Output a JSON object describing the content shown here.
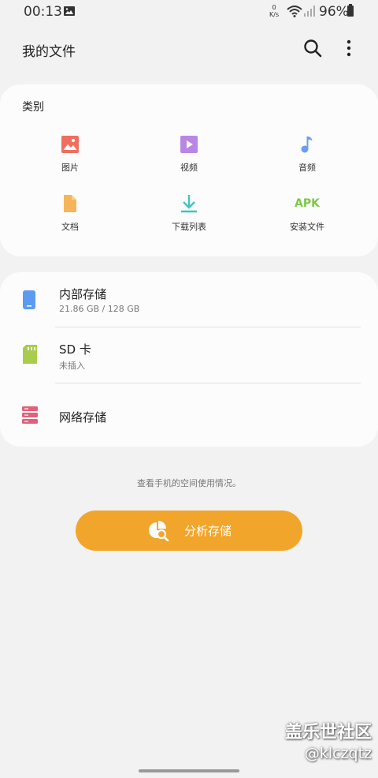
{
  "status_bar": {
    "time": "00:13",
    "speed_top": "0",
    "speed_bottom": "K/s",
    "battery": "96%"
  },
  "app_bar": {
    "title": "我的文件"
  },
  "categories": {
    "title": "类别",
    "items": [
      {
        "label": "图片",
        "icon": "image-icon",
        "color": "#ef6e5f"
      },
      {
        "label": "视频",
        "icon": "video-icon",
        "color": "#b986e6"
      },
      {
        "label": "音频",
        "icon": "music-icon",
        "color": "#6a9ef0"
      },
      {
        "label": "文档",
        "icon": "document-icon",
        "color": "#f5b55a"
      },
      {
        "label": "下载列表",
        "icon": "download-icon",
        "color": "#3fc6c0"
      },
      {
        "label": "安装文件",
        "icon": "apk-icon",
        "icon_text": "APK",
        "color": "#7ac943"
      }
    ]
  },
  "storage": {
    "items": [
      {
        "title": "内部存储",
        "subtitle": "21.86 GB / 128 GB",
        "icon": "phone-icon",
        "color": "#5b9cf0"
      },
      {
        "title": "SD 卡",
        "subtitle": "未插入",
        "icon": "sd-card-icon",
        "color": "#a9cc4e"
      },
      {
        "title": "网络存储",
        "subtitle": "",
        "icon": "server-icon",
        "color": "#e2607c"
      }
    ]
  },
  "hint": "查看手机的空间使用情况。",
  "analyze_button": {
    "label": "分析存储",
    "color": "#f2a52b"
  },
  "watermark": {
    "line1": "盖乐世社区",
    "line2": "@klczqtz"
  }
}
